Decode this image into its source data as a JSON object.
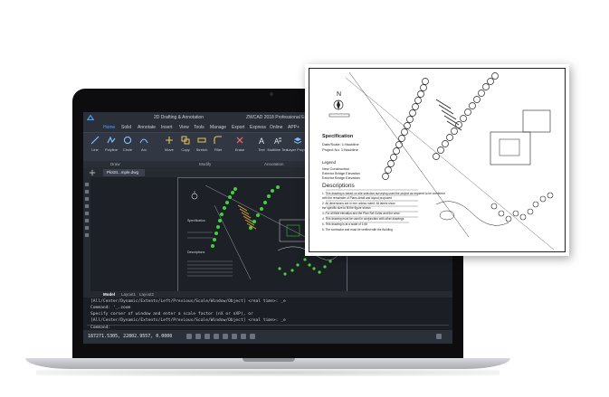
{
  "window": {
    "workspace": "2D Drafting & Annotation",
    "title": "ZWCAD 2018 Professional Edition - [PlotStyle_Sample.dwg]"
  },
  "ribbon": {
    "tabs": [
      "Home",
      "Solid",
      "Annotate",
      "Insert",
      "View",
      "Tools",
      "Manage",
      "Export",
      "Express",
      "Online",
      "APP+"
    ],
    "tools": [
      "Line",
      "Polyline",
      "Circle",
      "Arc",
      "Move",
      "Copy",
      "Stretch",
      "Fillet",
      "Erase",
      "Text",
      "Multiline Text",
      "Layer Properties"
    ],
    "panels": [
      "Draw",
      "Modify",
      "Annotation"
    ]
  },
  "drawing_tab": "PlotSt...mple.dwg",
  "layout_tabs": [
    "Model",
    "Layout1",
    "Layout2"
  ],
  "command": {
    "lines": [
      "[All/Center/Dynamic/Extents/Left/Previous/Scale/Window/Object] <real time>: _e",
      "Command: '_.zoom",
      "Specify corner of window and enter a scale factor (nX or nXP), or",
      "[All/Center/Dynamic/Extents/Left/Previous/Scale/Window/Object] <real time>: _e"
    ],
    "prompt": "Command:"
  },
  "status": {
    "coordinates": "187271.5305, 22802.9557, 0.0000"
  },
  "paper": {
    "heading": "Specification",
    "sub_lines": [
      "Date/Scale: 1:Nsubline",
      "Project No: 1:Nsubline"
    ],
    "legend_title": "Legend",
    "legend_items": [
      "New Construction",
      "Exterior Bridge Elevation",
      "Exterior Bridge Elevation"
    ],
    "descriptions_title": "Descriptions",
    "descriptions": [
      "1. This drawing is based on site selection surveying used the project as required to be combined",
      "with the remainder of Plans detail and layout proposed",
      "2. All dimensions are in mm unless noted. All labels show",
      "the specific size to fit the figure shown",
      "3. For all field elevation and the Plan Set Collar and the wind.",
      "4. This drawing must be used in conjunction with other drawings",
      "5. This drawing is at a scale of 1:##",
      "6. The contractor and must be verified with the Building"
    ]
  },
  "colors": {
    "accent": "#4aa3ff",
    "tree": "#3fd43a",
    "hatch": "#e0a93a",
    "screen_bg": "#1d2127"
  },
  "icons": [
    "app-logo-icon",
    "line-icon",
    "polyline-icon",
    "circle-icon",
    "arc-icon",
    "move-icon",
    "copy-icon",
    "stretch-icon",
    "fillet-icon",
    "erase-icon",
    "text-icon",
    "mtext-icon",
    "layer-icon"
  ]
}
